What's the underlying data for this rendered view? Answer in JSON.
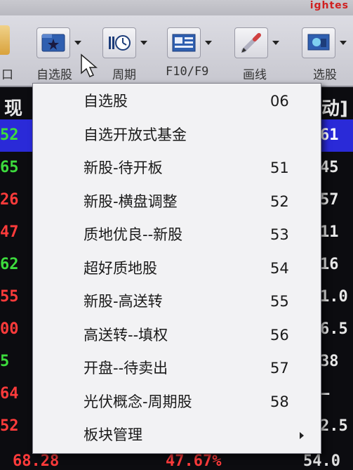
{
  "brand": "ightes",
  "toolbar": {
    "left_stub_label": "口",
    "buttons": [
      {
        "label": "自选股",
        "icon": "star-icon"
      },
      {
        "label": "周期",
        "icon": "clock-icon"
      },
      {
        "label": "F10/F9",
        "icon": "info-card-icon"
      },
      {
        "label": "画线",
        "icon": "pencil-icon"
      },
      {
        "label": "选股",
        "icon": "screen-icon"
      }
    ]
  },
  "table": {
    "left_header": "现",
    "right_header": "动]",
    "left_cells": [
      "52",
      "65",
      "26",
      "47",
      "62",
      "55",
      "00",
      "5",
      "64",
      "52"
    ],
    "right_cells": [
      "61",
      "45",
      "57",
      "11",
      "16",
      "1.0",
      "6.5",
      "38",
      "—",
      "2.5"
    ],
    "bottom_left": "68.28",
    "bottom_mid": "47.67%",
    "bottom_right": "54.0"
  },
  "colors": {
    "green": "#3ddc3d",
    "red": "#ff3b3b",
    "highlight": "#2a2ad8",
    "menu_bg": "#f2f2f4"
  },
  "menu": {
    "items": [
      {
        "label": "自选股",
        "num": "06"
      },
      {
        "label": "自选开放式基金",
        "num": ""
      },
      {
        "label": "新股-待开板",
        "num": "51"
      },
      {
        "label": "新股-横盘调整",
        "num": "52"
      },
      {
        "label": "质地优良--新股",
        "num": "53"
      },
      {
        "label": "超好质地股",
        "num": "54"
      },
      {
        "label": "新股-高送转",
        "num": "55"
      },
      {
        "label": "高送转--填权",
        "num": "56"
      },
      {
        "label": "开盘--待卖出",
        "num": "57"
      },
      {
        "label": "光伏概念-周期股",
        "num": "58"
      },
      {
        "label": "板块管理",
        "num": "",
        "submenu": true
      }
    ]
  }
}
